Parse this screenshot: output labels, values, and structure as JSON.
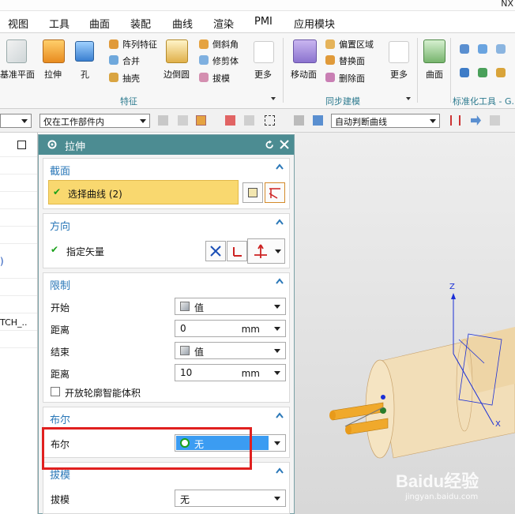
{
  "window": {
    "title": "NX"
  },
  "menu": [
    "视图",
    "工具",
    "曲面",
    "装配",
    "曲线",
    "渲染",
    "PMI",
    "应用模块"
  ],
  "ribbon": {
    "left_partial": "基准平面",
    "extrude": "拉伸",
    "hole": "孔",
    "pattern": "阵列特征",
    "unite": "合并",
    "shell": "抽壳",
    "edge_blend": "边倒圆",
    "chamfer": "倒斜角",
    "trim_body": "修剪体",
    "draft": "拔模",
    "more1": "更多",
    "move_face": "移动面",
    "offset_region": "偏置区域",
    "replace_face": "替换面",
    "delete_face": "删除面",
    "more2": "更多",
    "surface": "曲面",
    "group_feature": "特征",
    "group_sync": "同步建模",
    "group_std": "标准化工具 - G..."
  },
  "selection_bar": {
    "filter2": "仅在工作部件内",
    "curve_rule": "自动判断曲线"
  },
  "navigator": {
    "partial_text": "TCH_..",
    "partial_char": ")"
  },
  "dialog": {
    "title": "拉伸",
    "section": {
      "title": "截面",
      "select_curve": "选择曲线 (2)"
    },
    "direction": {
      "title": "方向",
      "vector": "指定矢量"
    },
    "limits": {
      "title": "限制",
      "start_label": "开始",
      "start_value": "值",
      "start_dist_label": "距离",
      "start_dist_value": "0",
      "start_unit": "mm",
      "end_label": "结束",
      "end_value": "值",
      "end_dist_label": "距离",
      "end_dist_value": "10",
      "end_unit": "mm",
      "open_profile": "开放轮廓智能体积"
    },
    "boolean": {
      "title": "布尔",
      "label": "布尔",
      "value": "无"
    },
    "draft": {
      "title": "拔模",
      "label": "拔模",
      "value": "无"
    }
  },
  "viewport": {
    "axis_z": "Z",
    "axis_x": "X",
    "watermark": "Baidu经验",
    "watermark_url": "jingyan.baidu.com"
  },
  "colors": {
    "accent": "#4c8c92",
    "highlight": "#f9d86f",
    "selected": "#3b9cf2",
    "annotation": "#e0201f"
  }
}
